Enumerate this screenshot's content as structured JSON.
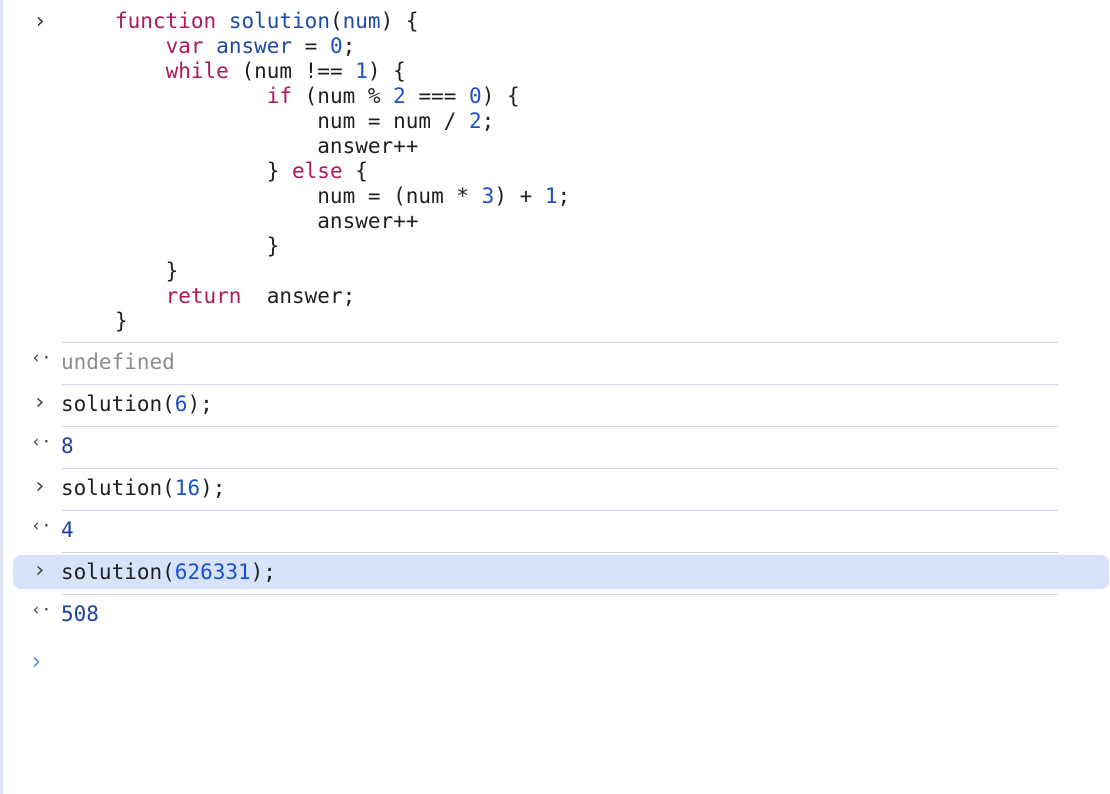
{
  "code_lines": [
    [
      {
        "t": "function",
        "c": "kw"
      },
      {
        "t": " ",
        "c": "plain"
      },
      {
        "t": "solution",
        "c": "fn"
      },
      {
        "t": "(",
        "c": "plain"
      },
      {
        "t": "num",
        "c": "var"
      },
      {
        "t": ") {",
        "c": "plain"
      }
    ],
    [
      {
        "t": "    ",
        "c": "plain"
      },
      {
        "t": "var",
        "c": "kw"
      },
      {
        "t": " ",
        "c": "plain"
      },
      {
        "t": "answer",
        "c": "var"
      },
      {
        "t": " = ",
        "c": "plain"
      },
      {
        "t": "0",
        "c": "num"
      },
      {
        "t": ";",
        "c": "plain"
      }
    ],
    [
      {
        "t": "    ",
        "c": "plain"
      },
      {
        "t": "while",
        "c": "kw"
      },
      {
        "t": " (num !== ",
        "c": "plain"
      },
      {
        "t": "1",
        "c": "num"
      },
      {
        "t": ") {",
        "c": "plain"
      }
    ],
    [
      {
        "t": "            ",
        "c": "plain"
      },
      {
        "t": "if",
        "c": "kw"
      },
      {
        "t": " (num % ",
        "c": "plain"
      },
      {
        "t": "2",
        "c": "num"
      },
      {
        "t": " === ",
        "c": "plain"
      },
      {
        "t": "0",
        "c": "num"
      },
      {
        "t": ") {",
        "c": "plain"
      }
    ],
    [
      {
        "t": "                num = num / ",
        "c": "plain"
      },
      {
        "t": "2",
        "c": "num"
      },
      {
        "t": ";",
        "c": "plain"
      }
    ],
    [
      {
        "t": "                answer++",
        "c": "plain"
      }
    ],
    [
      {
        "t": "            } ",
        "c": "plain"
      },
      {
        "t": "else",
        "c": "kw"
      },
      {
        "t": " {",
        "c": "plain"
      }
    ],
    [
      {
        "t": "                num = (num * ",
        "c": "plain"
      },
      {
        "t": "3",
        "c": "num"
      },
      {
        "t": ") + ",
        "c": "plain"
      },
      {
        "t": "1",
        "c": "num"
      },
      {
        "t": ";",
        "c": "plain"
      }
    ],
    [
      {
        "t": "                answer++",
        "c": "plain"
      }
    ],
    [
      {
        "t": "            }",
        "c": "plain"
      }
    ],
    [
      {
        "t": "    }",
        "c": "plain"
      }
    ],
    [
      {
        "t": "    ",
        "c": "plain"
      },
      {
        "t": "return",
        "c": "kw"
      },
      {
        "t": "  answer;",
        "c": "plain"
      }
    ],
    [
      {
        "t": "}",
        "c": "plain"
      }
    ]
  ],
  "icons": {
    "prompt": "›",
    "result": "‹·"
  },
  "entries": [
    {
      "kind": "result",
      "parts": [
        {
          "t": "undefined",
          "c": "undef"
        }
      ]
    },
    {
      "kind": "input",
      "parts": [
        {
          "t": "solution(",
          "c": "plain"
        },
        {
          "t": "6",
          "c": "num"
        },
        {
          "t": ");",
          "c": "plain"
        }
      ]
    },
    {
      "kind": "result",
      "parts": [
        {
          "t": "8",
          "c": "outnum"
        }
      ]
    },
    {
      "kind": "input",
      "parts": [
        {
          "t": "solution(",
          "c": "plain"
        },
        {
          "t": "16",
          "c": "num"
        },
        {
          "t": ");",
          "c": "plain"
        }
      ]
    },
    {
      "kind": "result",
      "parts": [
        {
          "t": "4",
          "c": "outnum"
        }
      ]
    },
    {
      "kind": "input",
      "highlight": true,
      "parts": [
        {
          "t": "solution(",
          "c": "plain"
        },
        {
          "t": "626331",
          "c": "num"
        },
        {
          "t": ");",
          "c": "plain"
        }
      ]
    },
    {
      "kind": "result",
      "parts": [
        {
          "t": "508",
          "c": "outnum"
        }
      ]
    }
  ],
  "colors": {
    "keyword": "#b0185d",
    "identifier": "#1d4aa8",
    "number": "#1a4fd0",
    "highlight": "#d7e3fb",
    "prompt": "#5b8dea"
  }
}
